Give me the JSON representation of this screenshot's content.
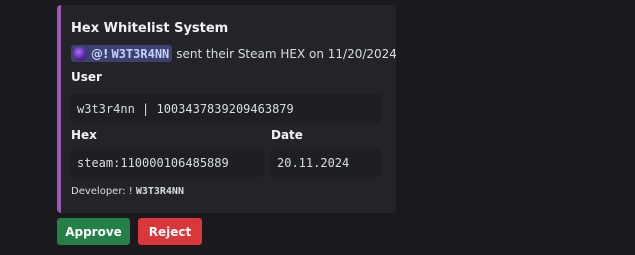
{
  "embed": {
    "accent_color": "#9b59b6",
    "title": "Hex Whitelist System",
    "description": {
      "mention_prefix": "@!",
      "mention_name": "W3T3R4NN",
      "text": "sent their Steam HEX on 11/20/2024."
    },
    "fields": {
      "user": {
        "label": "User",
        "value": "w3t3r4nn | 1003437839209463879"
      },
      "hex": {
        "label": "Hex",
        "value": "steam:110000106485889"
      },
      "date": {
        "label": "Date",
        "value": "20.11.2024"
      }
    },
    "footer": {
      "prefix": "Developer: !",
      "name": "W3T3R4NN"
    }
  },
  "buttons": {
    "approve_label": "Approve",
    "reject_label": "Reject",
    "approve_color": "#248046",
    "reject_color": "#da373c"
  }
}
